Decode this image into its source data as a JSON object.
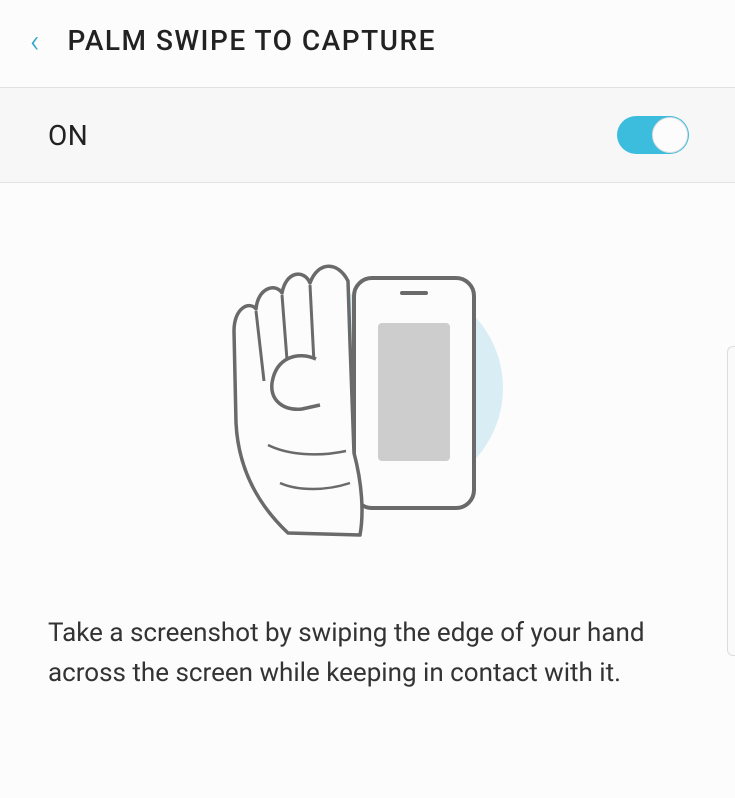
{
  "header": {
    "title": "PALM SWIPE TO CAPTURE"
  },
  "toggle": {
    "label": "ON",
    "state": true
  },
  "description": "Take a screenshot by swiping the edge of your hand across the screen while keeping in contact with it."
}
